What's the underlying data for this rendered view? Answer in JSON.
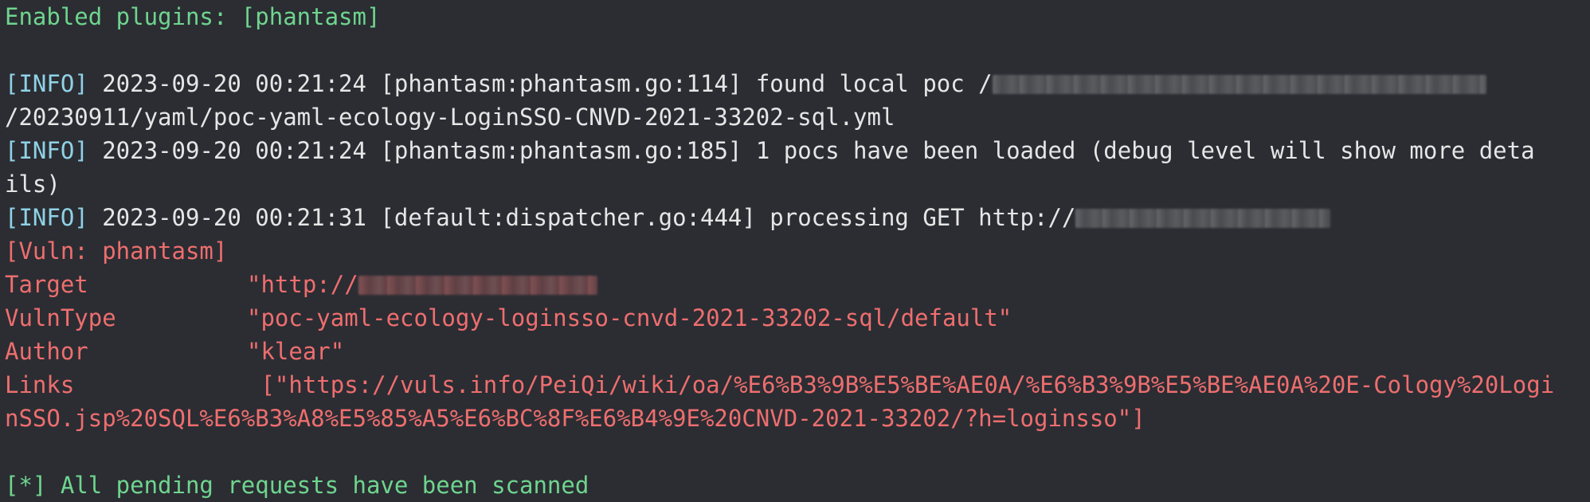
{
  "terminal": {
    "line1": "Enabled plugins: [phantasm]",
    "info1": {
      "tag": "[INFO]",
      "text": " 2023-09-20 00:21:24 [phantasm:phantasm.go:114] found local poc /"
    },
    "info1_cont": "/20230911/yaml/poc-yaml-ecology-LoginSSO-CNVD-2021-33202-sql.yml",
    "info2": {
      "tag": "[INFO]",
      "text": " 2023-09-20 00:21:24 [phantasm:phantasm.go:185] 1 pocs have been loaded (debug level will show more deta"
    },
    "info2_cont": "ils)",
    "info3": {
      "tag": "[INFO]",
      "text": " 2023-09-20 00:21:31 [default:dispatcher.go:444] processing GET http://"
    },
    "vuln_header": "[Vuln: phantasm]",
    "target": {
      "key": "Target",
      "value": "\"http://"
    },
    "vulntype": {
      "key": "VulnType",
      "value": "\"poc-yaml-ecology-loginsso-cnvd-2021-33202-sql/default\""
    },
    "author": {
      "key": "Author",
      "value": "\"klear\""
    },
    "links": {
      "key": "Links",
      "value": " [\"https://vuls.info/PeiQi/wiki/oa/%E6%B3%9B%E5%BE%AE0A/%E6%B3%9B%E5%BE%AE0A%20E-Cology%20Logi",
      "cont": "nSSO.jsp%20SQL%E6%B3%A8%E5%85%A5%E6%BC%8F%E6%B4%9E%20CNVD-2021-33202/?h=loginsso\"]"
    },
    "final": "[*] All pending requests have been scanned"
  }
}
